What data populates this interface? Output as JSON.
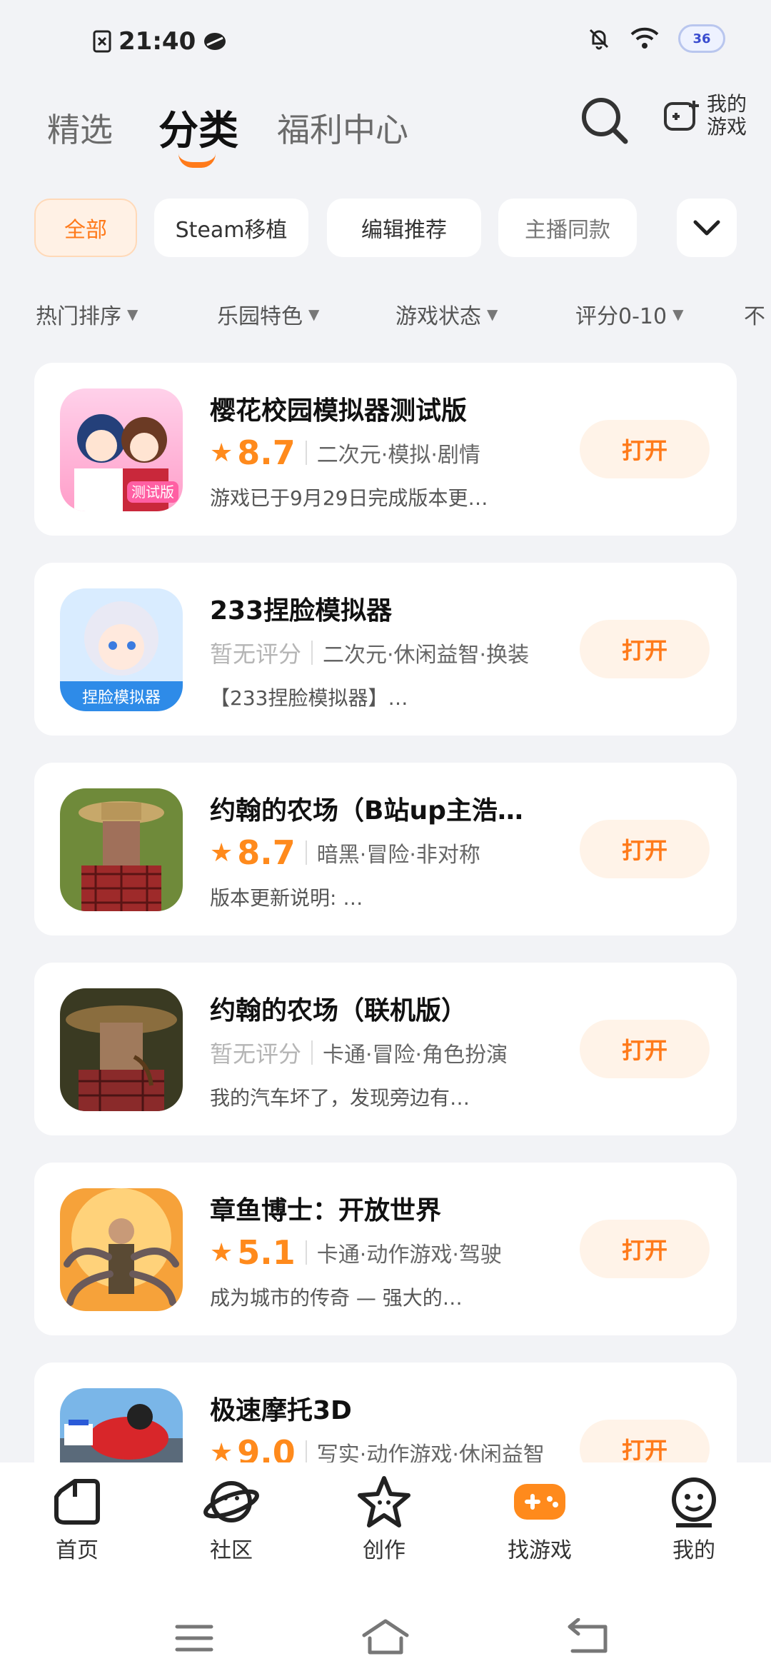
{
  "status": {
    "time": "21:40",
    "battery": "36"
  },
  "topnav": {
    "tabs": [
      {
        "label": "精选"
      },
      {
        "label": "分类"
      },
      {
        "label": "福利中心"
      }
    ],
    "my_games": "我的游戏"
  },
  "chips": [
    {
      "label": "全部"
    },
    {
      "label": "Steam移植"
    },
    {
      "label": "编辑推荐"
    },
    {
      "label": "主播同款"
    }
  ],
  "filters": [
    {
      "label": "热门排序"
    },
    {
      "label": "乐园特色"
    },
    {
      "label": "游戏状态"
    },
    {
      "label": "评分0-10"
    },
    {
      "label": "不"
    }
  ],
  "games": [
    {
      "title": "樱花校园模拟器测试版",
      "score": "8.7",
      "tags": "二次元·模拟·剧情",
      "desc": "游戏已于9月29日完成版本更…",
      "button": "打开",
      "icon_badge": "测试版"
    },
    {
      "title": "233捏脸模拟器",
      "score": "暂无评分",
      "tags": "二次元·休闲益智·换装",
      "desc": "【233捏脸模拟器】…",
      "button": "打开",
      "icon_badge": "捏脸模拟器"
    },
    {
      "title": "约翰的农场（B站up主浩…",
      "score": "8.7",
      "tags": "暗黑·冒险·非对称",
      "desc": "版本更新说明: …",
      "button": "打开"
    },
    {
      "title": "约翰的农场（联机版）",
      "score": "暂无评分",
      "tags": "卡通·冒险·角色扮演",
      "desc": "我的汽车坏了，发现旁边有…",
      "button": "打开"
    },
    {
      "title": "章鱼博士：开放世界",
      "score": "5.1",
      "tags": "卡通·动作游戏·驾驶",
      "desc": "成为城市的传奇 — 强大的…",
      "button": "打开"
    },
    {
      "title": "极速摩托3D",
      "score": "9.0",
      "tags": "写实·动作游戏·休闲益智",
      "desc": "",
      "button": "打开"
    }
  ],
  "bottomnav": [
    {
      "label": "首页"
    },
    {
      "label": "社区"
    },
    {
      "label": "创作"
    },
    {
      "label": "找游戏"
    },
    {
      "label": "我的"
    }
  ],
  "colors": {
    "accent": "#ff7a1a",
    "background": "#f2f3f6"
  }
}
